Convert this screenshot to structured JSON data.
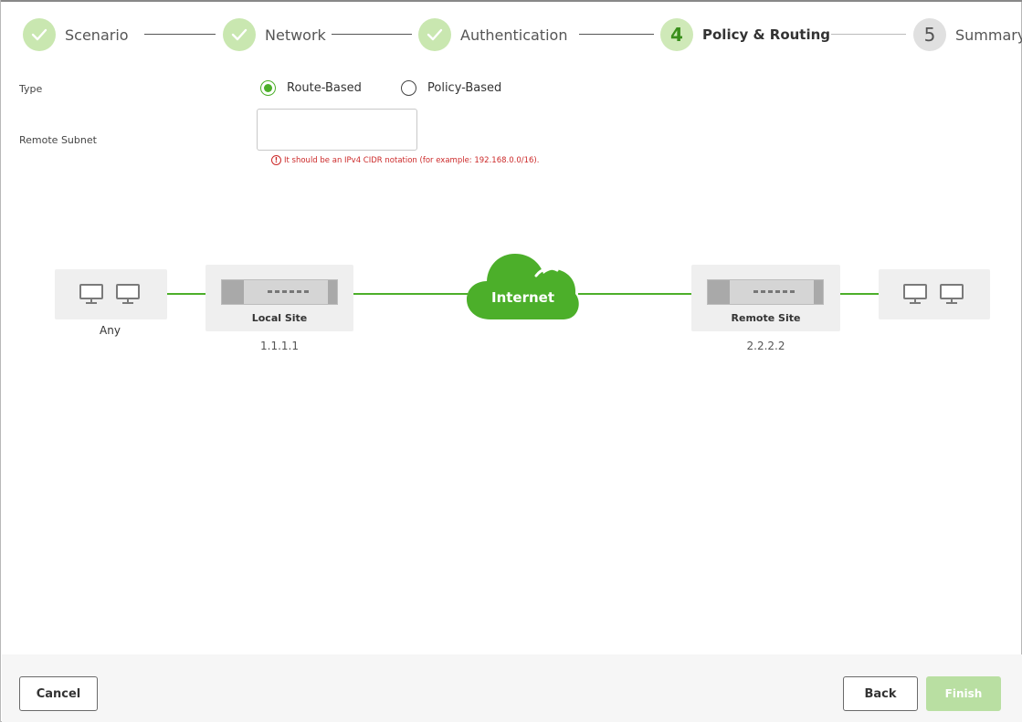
{
  "wizard": {
    "steps": [
      {
        "number": "",
        "label": "Scenario",
        "state": "done"
      },
      {
        "number": "",
        "label": "Network",
        "state": "done"
      },
      {
        "number": "",
        "label": "Authentication",
        "state": "done"
      },
      {
        "number": "4",
        "label": "Policy & Routing",
        "state": "active"
      },
      {
        "number": "5",
        "label": "Summary",
        "state": "todo"
      }
    ]
  },
  "form": {
    "type_label": "Type",
    "type_options": [
      {
        "label": "Route-Based",
        "selected": true
      },
      {
        "label": "Policy-Based",
        "selected": false
      }
    ],
    "remote_subnet_label": "Remote Subnet",
    "remote_subnet_value": "",
    "remote_subnet_error": "It should be an IPv4 CIDR notation (for example: 192.168.0.0/16)."
  },
  "topology": {
    "local_hosts_label": "Any",
    "local_site": {
      "name": "Local Site",
      "ip": "1.1.1.1"
    },
    "internet_label": "Internet",
    "remote_site": {
      "name": "Remote Site",
      "ip": "2.2.2.2"
    }
  },
  "footer": {
    "cancel_label": "Cancel",
    "back_label": "Back",
    "finish_label": "Finish"
  },
  "colors": {
    "accent_green": "#4caf2a",
    "done_circle": "#c9e7b0",
    "error_red": "#cc2a2a",
    "finish_disabled": "#b9dfa2"
  }
}
